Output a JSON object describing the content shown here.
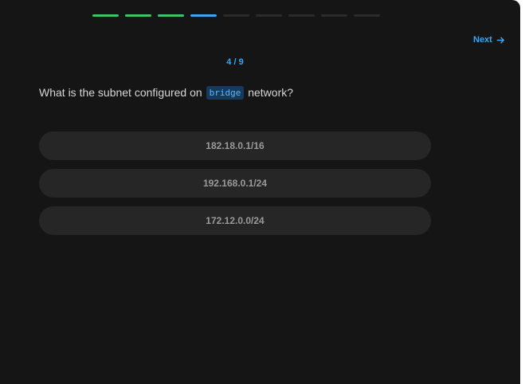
{
  "progress": {
    "total": 9,
    "completed": 3,
    "current": 4,
    "colors": {
      "done": "#3dc46b",
      "current": "#3aa6f5",
      "pending": "#2b2b2b"
    }
  },
  "nav": {
    "next_label": "Next",
    "next_icon": "arrow-right-icon"
  },
  "counter": "4 / 9",
  "question": {
    "prefix": "What is the subnet configured on",
    "code": "bridge",
    "suffix": "network?"
  },
  "options": [
    "182.18.0.1/16",
    "192.168.0.1/24",
    "172.12.0.0/24"
  ]
}
